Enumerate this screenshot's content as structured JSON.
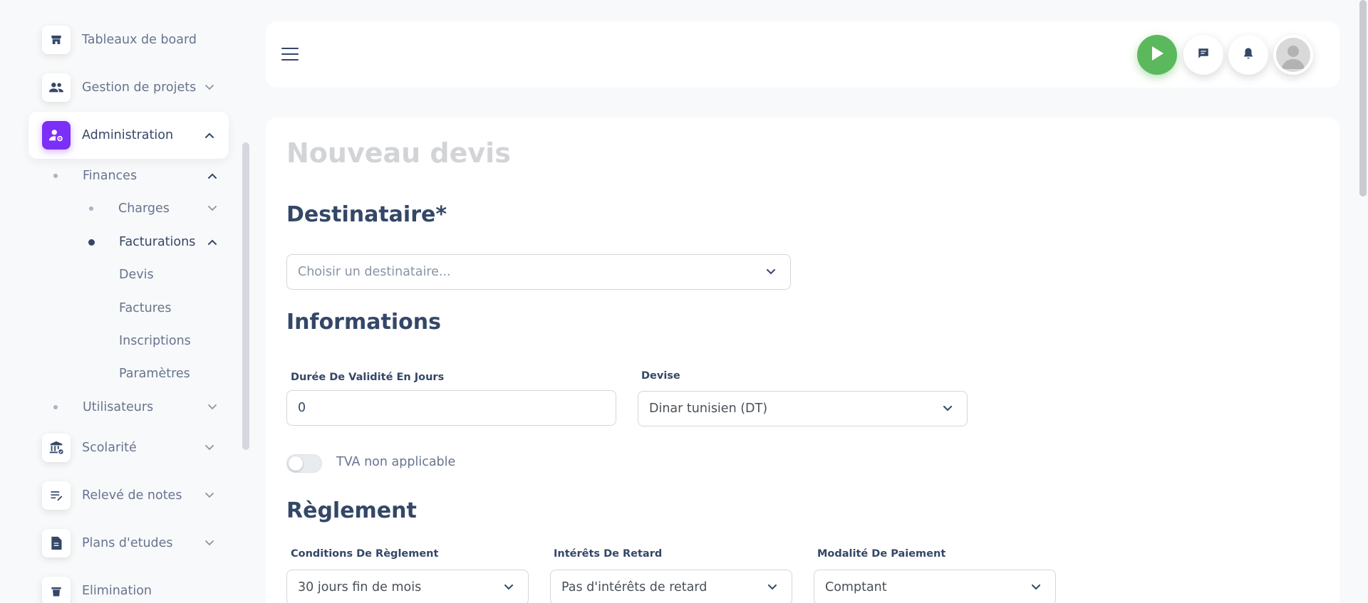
{
  "sidebar": {
    "items": [
      {
        "label": "Tableaux de board",
        "icon": "shop-icon"
      },
      {
        "label": "Gestion de projets",
        "icon": "people-icon"
      },
      {
        "label": "Administration",
        "icon": "admin-settings-icon"
      },
      {
        "label": "Scolarité",
        "icon": "institution-icon"
      },
      {
        "label": "Relevé de notes",
        "icon": "edit-note-icon"
      },
      {
        "label": "Plans d'etudes",
        "icon": "document-icon"
      },
      {
        "label": "Elimination",
        "icon": "elimination-icon"
      }
    ],
    "sub_items": {
      "finances": "Finances",
      "charges": "Charges",
      "facturations": "Facturations",
      "devis": "Devis",
      "factures": "Factures",
      "inscriptions": "Inscriptions",
      "parametres": "Paramètres",
      "utilisateurs": "Utilisateurs"
    }
  },
  "topbar": {
    "buttons": [
      "play-icon",
      "chat-icon",
      "bell-icon",
      "avatar"
    ]
  },
  "main": {
    "page_title": "Nouveau devis",
    "destinataire": {
      "title": "Destinataire*",
      "placeholder": "Choisir un destinataire..."
    },
    "informations": {
      "title": "Informations",
      "duree_label": "Durée De Validité En Jours",
      "duree_value": "0",
      "devise_label": "Devise",
      "devise_value": "Dinar tunisien (DT)",
      "tva_label": "TVA non applicable",
      "tva_enabled": false
    },
    "reglement": {
      "title": "Règlement",
      "conditions_label": "Conditions De Règlement",
      "conditions_value": "30 jours fin de mois",
      "interets_label": "Intérêts De Retard",
      "interets_value": "Pas d'intérêts de retard",
      "modalite_label": "Modalité De Paiement",
      "modalite_value": "Comptant"
    }
  },
  "colors": {
    "accent": "#7b2ff7",
    "play": "#5cb85c",
    "text_dark": "#344767",
    "text_muted": "#67748e"
  }
}
